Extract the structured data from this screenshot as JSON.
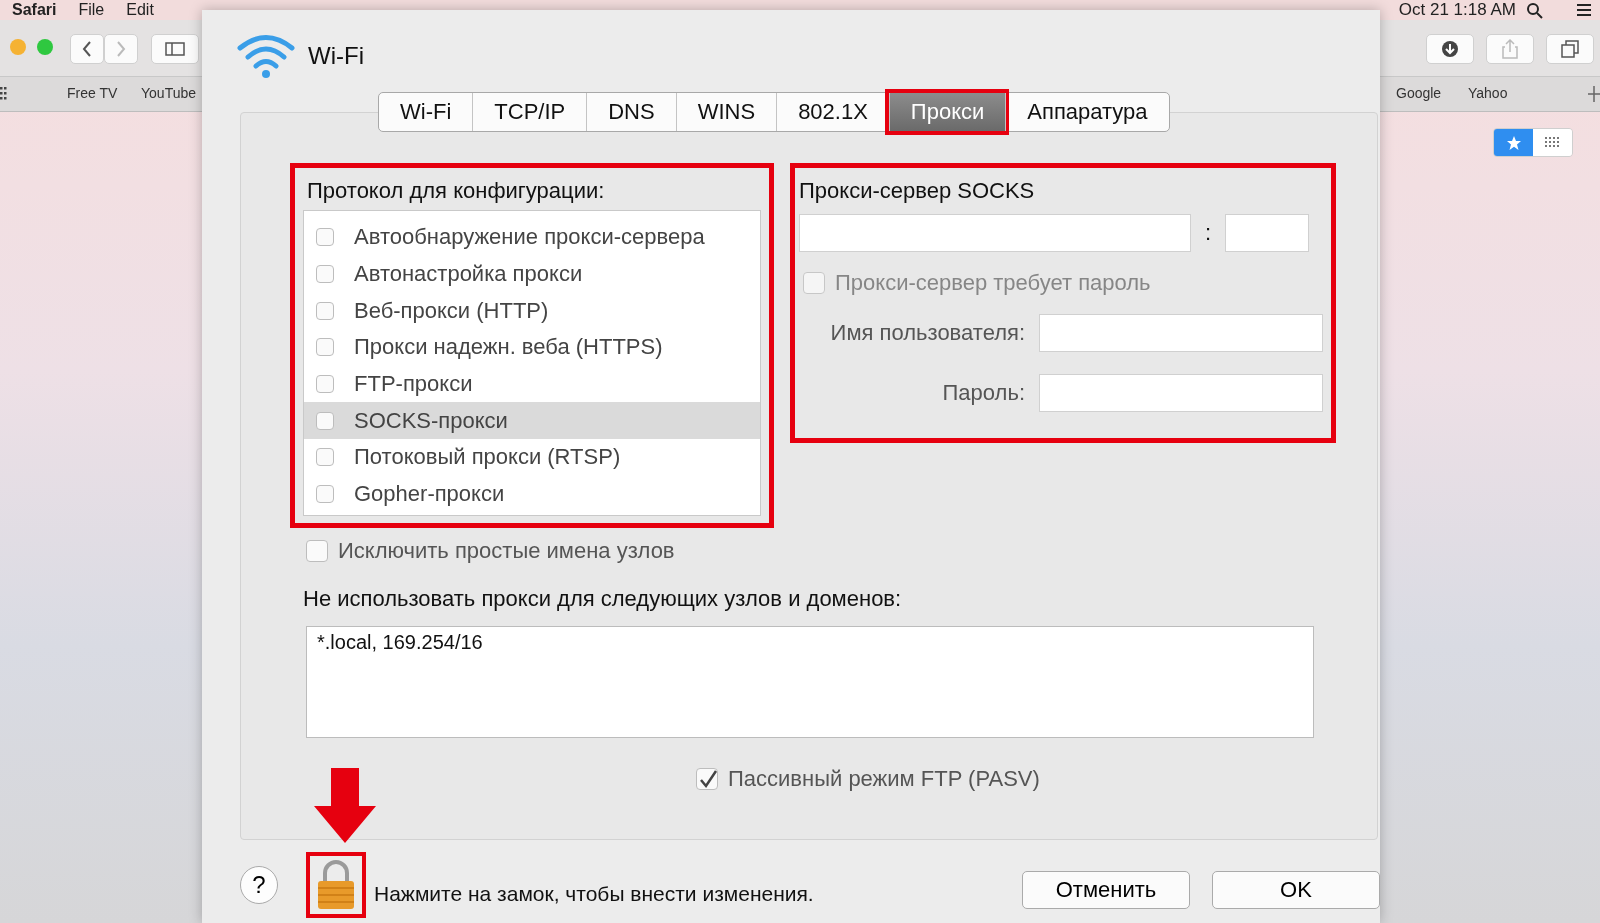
{
  "menu_bar": {
    "app": "Safari",
    "items": [
      "File",
      "Edit"
    ],
    "clock": "Oct 21  1:18 AM"
  },
  "browser": {
    "bookmarks_left": [
      "Free TV",
      "YouTube"
    ],
    "bookmarks_right": [
      "Google",
      "Yahoo"
    ],
    "view_switch": [
      {
        "kind": "favorites",
        "selected": true
      },
      {
        "kind": "grid",
        "selected": false
      }
    ]
  },
  "sheet": {
    "title": "Wi-Fi",
    "tabs": [
      {
        "label": "Wi-Fi",
        "selected": false,
        "highlighted": false
      },
      {
        "label": "TCP/IP",
        "selected": false,
        "highlighted": false
      },
      {
        "label": "DNS",
        "selected": false,
        "highlighted": false
      },
      {
        "label": "WINS",
        "selected": false,
        "highlighted": false
      },
      {
        "label": "802.1X",
        "selected": false,
        "highlighted": false
      },
      {
        "label": "Прокси",
        "selected": true,
        "highlighted": true
      },
      {
        "label": "Аппаратура",
        "selected": false,
        "highlighted": false
      }
    ],
    "protocols": {
      "label": "Протокол для конфигурации:",
      "highlighted": true,
      "items": [
        {
          "label": "Автообнаружение прокси-сервера",
          "checked": false,
          "selected": false
        },
        {
          "label": "Автонастройка прокси",
          "checked": false,
          "selected": false
        },
        {
          "label": "Веб-прокси (HTTP)",
          "checked": false,
          "selected": false
        },
        {
          "label": "Прокси надежн. веба (HTTPS)",
          "checked": false,
          "selected": false
        },
        {
          "label": "FTP-прокси",
          "checked": false,
          "selected": false
        },
        {
          "label": "SOCKS-прокси",
          "checked": false,
          "selected": true
        },
        {
          "label": "Потоковый прокси (RTSP)",
          "checked": false,
          "selected": false
        },
        {
          "label": "Gopher-прокси",
          "checked": false,
          "selected": false
        }
      ]
    },
    "socks": {
      "title": "Прокси-сервер SOCKS",
      "highlighted": true,
      "separator": ":",
      "password_required": {
        "label": "Прокси-сервер требует пароль",
        "checked": false,
        "disabled": true
      },
      "username_label": "Имя пользователя:",
      "password_label": "Пароль:"
    },
    "exclude_simple": {
      "label": "Исключить простые имена узлов",
      "checked": false
    },
    "bypass": {
      "label": "Не использовать прокси для следующих узлов и доменов:",
      "value": "*.local, 169.254/16"
    },
    "pasv": {
      "label": "Пассивный режим FTP (PASV)",
      "checked": true
    },
    "footer": {
      "help": "?",
      "lock_text": "Нажмите на замок, чтобы внести изменения.",
      "lock_highlighted": true,
      "buttons": [
        "Отменить",
        "OK"
      ]
    }
  }
}
